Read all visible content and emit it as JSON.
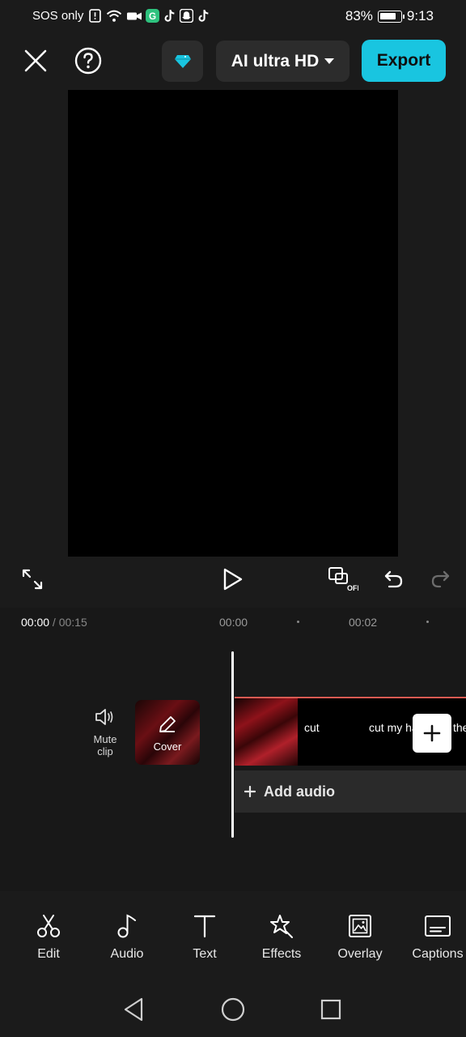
{
  "status_bar": {
    "left_text": "SOS only",
    "battery": "83%",
    "battery_level": 0.83,
    "time": "9:13",
    "icons": [
      "alert-icon",
      "wifi-icon",
      "video-icon",
      "grammarly-icon",
      "tiktok-icon",
      "snapchat-icon",
      "tiktok-icon"
    ]
  },
  "toolbar": {
    "close_icon": "close-icon",
    "help_icon": "help-icon",
    "premium_icon": "diamond-icon",
    "quality_label": "AI ultra HD",
    "export_label": "Export"
  },
  "timeline": {
    "current_time": "00:00",
    "total_time": " / 00:15",
    "ruler": [
      "00:00",
      "00:02"
    ],
    "mute_clip_label": "Mute clip",
    "cover_label": "Cover",
    "clip_texts": [
      "cut",
      "cut my ha",
      "the"
    ],
    "add_audio_label": "Add audio"
  },
  "tools": [
    {
      "label": "Edit",
      "icon": "scissors-icon"
    },
    {
      "label": "Audio",
      "icon": "music-note-icon"
    },
    {
      "label": "Text",
      "icon": "text-icon"
    },
    {
      "label": "Effects",
      "icon": "effects-icon"
    },
    {
      "label": "Overlay",
      "icon": "overlay-icon"
    },
    {
      "label": "Captions",
      "icon": "captions-icon"
    }
  ],
  "colors": {
    "accent": "#19c5e0",
    "background": "#1b1b1b",
    "clip_border": "#d95a52"
  }
}
